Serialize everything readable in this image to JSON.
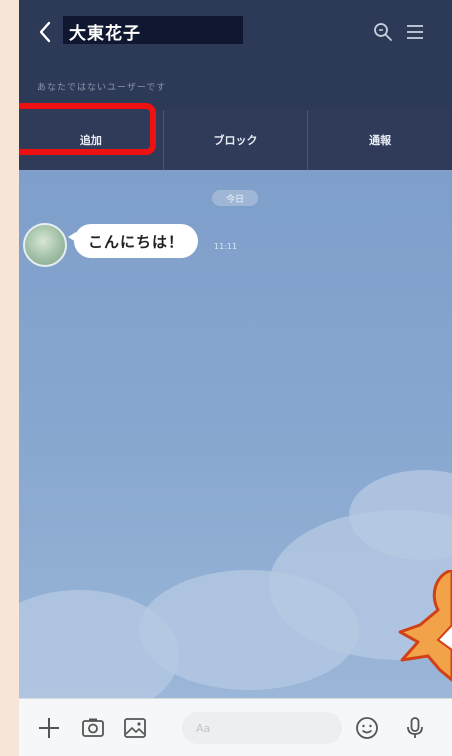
{
  "header": {
    "contact_name": "大東花子",
    "notice": "あなたではないユーザーです"
  },
  "actions": [
    {
      "label": "追加"
    },
    {
      "label": "ブロック"
    },
    {
      "label": "通報"
    }
  ],
  "chat": {
    "date_label": "今日",
    "messages": [
      {
        "text": "こんにちは！",
        "time": "11:11"
      }
    ]
  },
  "input": {
    "placeholder": "Aa"
  },
  "colors": {
    "header_bg": "#2c3a57",
    "highlight": "#ee1111",
    "chat_bg": "#7f9fc8"
  }
}
